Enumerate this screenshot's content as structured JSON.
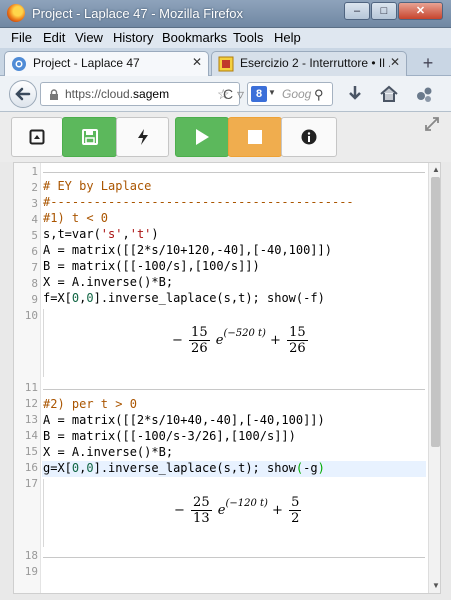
{
  "window": {
    "title": "Project - Laplace 47 - Mozilla Firefox",
    "minimize": "–",
    "maximize": "□",
    "close": "✕"
  },
  "menu": [
    "File",
    "Edit",
    "View",
    "History",
    "Bookmarks",
    "Tools",
    "Help"
  ],
  "tabs": [
    {
      "label": "Project - Laplace 47",
      "icon": "sage-icon",
      "close": "✕"
    },
    {
      "label": "Esercizio 2 - Interruttore • Il ...",
      "icon": "site-icon",
      "close": "✕"
    }
  ],
  "new_tab": "+",
  "navbar": {
    "url_prefix": "https://cloud.",
    "url_bold": "sagem",
    "search_placeholder": "Goog",
    "search_engine": "8"
  },
  "toolbar": {
    "buttons": [
      "frame",
      "save",
      "interrupt",
      "run",
      "stop",
      "info"
    ],
    "save_color": "#5cb85c",
    "stop_color": "#f0ad4e"
  },
  "editor": {
    "line_numbers": [
      "1",
      "2",
      "3",
      "4",
      "5",
      "6",
      "7",
      "8",
      "9",
      "10",
      "11",
      "12",
      "13",
      "14",
      "15",
      "16",
      "17",
      "18",
      "19"
    ],
    "lines": {
      "l2": "# EY by Laplace",
      "l3": "#------------------------------------------",
      "l4a": "#1) t ",
      "l4b": "< 0",
      "l5a": "s,t=var(",
      "l5b": "'s'",
      "l5c": ",",
      "l5d": "'t'",
      "l5e": ")",
      "l6": "A = matrix([[2*s/10+120,-40],[-40,100]])",
      "l7": "B = matrix([[-100/s],[100/s]])",
      "l8": "X = A.inverse()*B;",
      "l9a": "f=X[",
      "l9b": "0",
      "l9c": ",",
      "l9d": "0",
      "l9e": "].inverse_laplace(s,t); show(-f)",
      "l12": "#2) per t > 0",
      "l13": "A = matrix([[2*s/10+40,-40],[-40,100]])",
      "l14": "B = matrix([[-100/s-3/26],[100/s]])",
      "l15": "X = A.inverse()*B;",
      "l16a": "g=X[",
      "l16b": "0",
      "l16c": ",",
      "l16d": "0",
      "l16e": "].inverse_laplace(s,t); show",
      "l16f": "(",
      "l16g": "-g",
      "l16h": ")"
    },
    "output1": {
      "sign": "−",
      "num1": "15",
      "den1": "26",
      "e": "e",
      "exp": "(−520 t)",
      "plus": "+",
      "num2": "15",
      "den2": "26"
    },
    "output2": {
      "sign": "−",
      "num1": "25",
      "den1": "13",
      "e": "e",
      "exp": "(−120 t)",
      "plus": "+",
      "num2": "5",
      "den2": "2"
    }
  }
}
